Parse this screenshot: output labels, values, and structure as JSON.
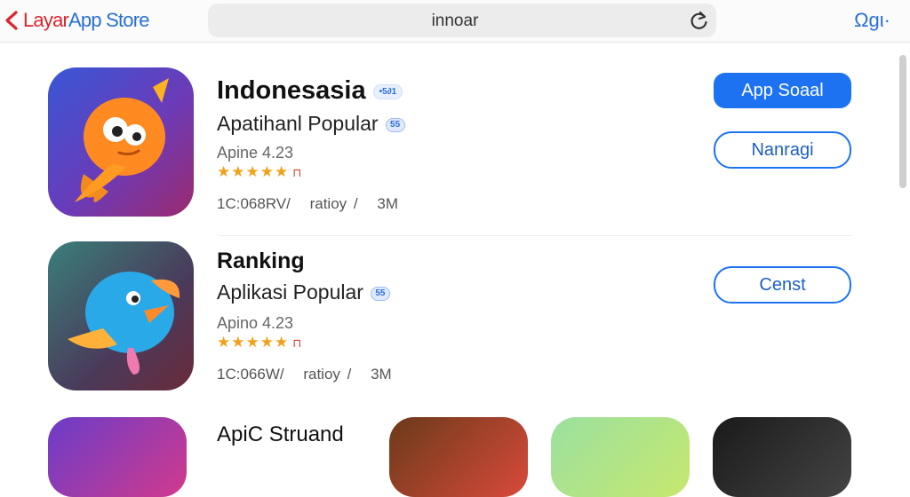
{
  "header": {
    "brand_part1": "Layar",
    "brand_part2": "App Store",
    "url": "innoar",
    "right_label": "Ωgι·"
  },
  "apps": [
    {
      "title": "Indonesasia",
      "badge": "•5∂1",
      "subtitle": "Apatihanl Popular",
      "subtitle_badge": "55",
      "rating_text": "Apine 4.23",
      "stars": "★★★★★",
      "gift": "⊓",
      "meta": [
        "1C:068RV/",
        "ratioy /",
        "3M"
      ],
      "primary_button": "App Soaal",
      "secondary_button": "Nanragi"
    },
    {
      "title": "Ranking",
      "subtitle": "Aplikasi Popular",
      "subtitle_badge": "55",
      "rating_text": "Apino 4.23",
      "stars": "★★★★★",
      "gift": "⊓",
      "meta": [
        "1C:066W/",
        "ratioy /",
        "3M"
      ],
      "secondary_button": "Censt"
    }
  ],
  "row3": {
    "title": "ApiC Struand"
  }
}
